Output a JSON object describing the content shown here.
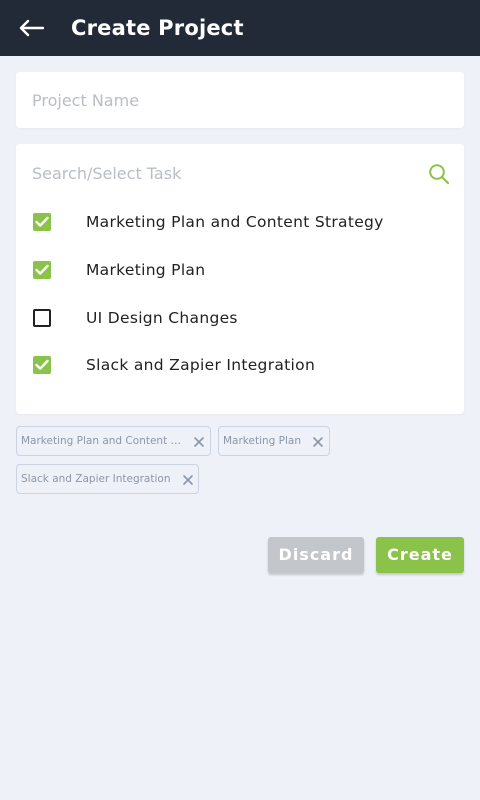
{
  "header": {
    "title": "Create Project",
    "back_icon": "arrow-left-icon"
  },
  "project_name": {
    "value": "",
    "placeholder": "Project Name"
  },
  "task_search": {
    "value": "",
    "placeholder": "Search/Select Task",
    "icon": "search-icon"
  },
  "tasks": [
    {
      "label": "Marketing Plan and Content Strategy",
      "checked": true
    },
    {
      "label": "Marketing Plan",
      "checked": true
    },
    {
      "label": "UI Design Changes",
      "checked": false
    },
    {
      "label": "Slack and Zapier Integration",
      "checked": true
    }
  ],
  "selected_chips": [
    {
      "label": "Marketing Plan and Content Strategy",
      "display": "Marketing Plan and Content St..."
    },
    {
      "label": "Marketing Plan",
      "display": "Marketing Plan"
    },
    {
      "label": "Slack and Zapier Integration",
      "display": "Slack and Zapier Integration"
    }
  ],
  "actions": {
    "discard_label": "Discard",
    "create_label": "Create"
  },
  "colors": {
    "appbar": "#232a37",
    "accent": "#8bc34a",
    "background": "#eef2f8",
    "disabled": "#c3c6cb"
  }
}
